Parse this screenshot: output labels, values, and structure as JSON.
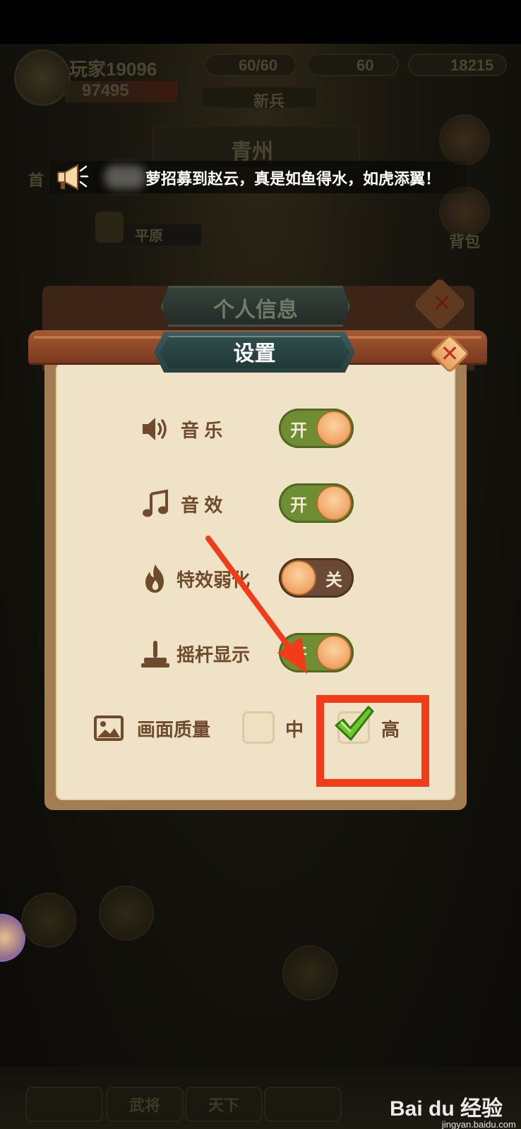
{
  "hud": {
    "player_name": "玩家19096",
    "score": "97495",
    "stamina": "60/60",
    "resource_2": "60",
    "resource_3": "18215",
    "newbie_label": "新兵",
    "region_name": "青州",
    "area_label": "平原",
    "right_label_1": "背包",
    "left_label_1": "首"
  },
  "announcement": {
    "text": "萝招募到赵云，真是如鱼得水，如虎添翼！",
    "icon": "megaphone-icon"
  },
  "back_dialog": {
    "title": "个人信息",
    "close_glyph": "✕"
  },
  "settings": {
    "title": "设置",
    "close_glyph": "✕",
    "rows": [
      {
        "label": "音 乐",
        "icon": "speaker-icon",
        "state_text": "开",
        "on": true
      },
      {
        "label": "音 效",
        "icon": "music-note-icon",
        "state_text": "开",
        "on": true
      },
      {
        "label": "特效弱化",
        "icon": "flame-icon",
        "state_text": "关",
        "on": false
      },
      {
        "label": "摇杆显示",
        "icon": "joystick-icon",
        "state_text": "开",
        "on": true
      }
    ],
    "quality": {
      "label": "画面质量",
      "icon": "image-icon",
      "options": [
        {
          "label": "中",
          "checked": false
        },
        {
          "label": "高",
          "checked": true
        }
      ]
    }
  },
  "bottom_nav": [
    "武将",
    "天下"
  ],
  "watermark": {
    "brand": "Bai du 经验",
    "url": "jingyan.baidu.com"
  },
  "colors": {
    "panel": "#f0e2c6",
    "toggle_on": "#6f8d33",
    "toggle_off": "#6b4a35",
    "annotation": "#f23b18",
    "check": "#6cc62c"
  }
}
